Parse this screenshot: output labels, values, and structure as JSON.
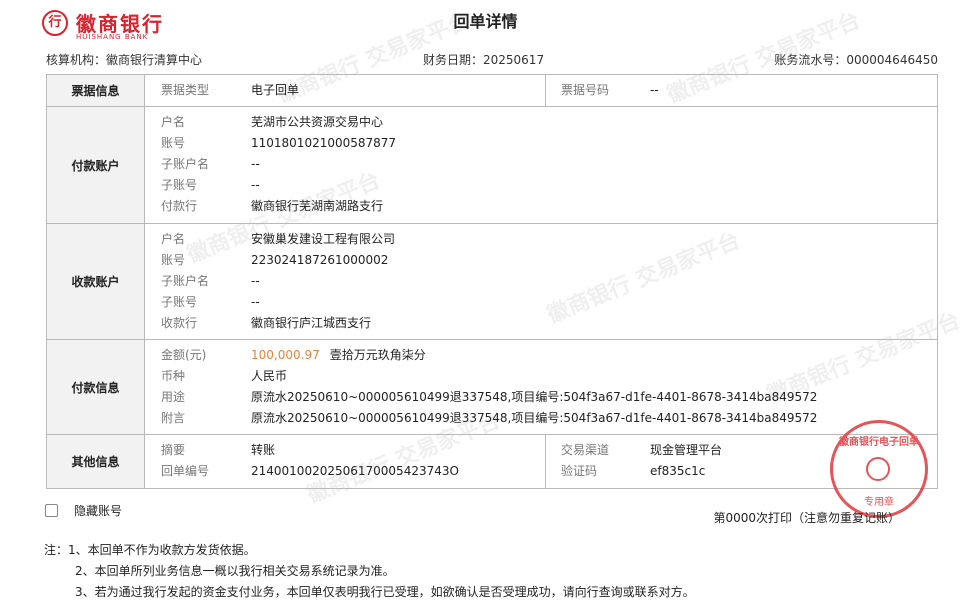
{
  "brand": {
    "name_cn": "徽商银行",
    "name_en": "HUISHANG BANK",
    "mark": "行"
  },
  "page": {
    "title": "回单详情"
  },
  "meta": {
    "org": "核算机构：徽商银行清算中心",
    "date": "财务日期：20250617",
    "serial": "账务流水号：000004646450"
  },
  "sections": {
    "bill": {
      "header": "票据信息",
      "type_label": "票据类型",
      "type_value": "电子回单",
      "no_label": "票据号码",
      "no_value": "--"
    },
    "payer": {
      "header": "付款账户",
      "rows": [
        {
          "label": "户名",
          "value": "芜湖市公共资源交易中心"
        },
        {
          "label": "账号",
          "value": "1101801021000587877"
        },
        {
          "label": "子账户名",
          "value": "--"
        },
        {
          "label": "子账号",
          "value": "--"
        },
        {
          "label": "付款行",
          "value": "徽商银行芜湖南湖路支行"
        }
      ]
    },
    "payee": {
      "header": "收款账户",
      "rows": [
        {
          "label": "户名",
          "value": "安徽巢发建设工程有限公司"
        },
        {
          "label": "账号",
          "value": "223024187261000002"
        },
        {
          "label": "子账户名",
          "value": "--"
        },
        {
          "label": "子账号",
          "value": "--"
        },
        {
          "label": "收款行",
          "value": "徽商银行庐江城西支行"
        }
      ]
    },
    "payment": {
      "header": "付款信息",
      "amount_label": "金额(元)",
      "amount_value": "100,000.97",
      "amount_cn": "壹拾万元玖角柒分",
      "currency_label": "币种",
      "currency_value": "人民币",
      "purpose_label": "用途",
      "purpose_value": "原流水20250610~000005610499退337548,项目编号:504f3a67-d1fe-4401-8678-3414ba849572",
      "note_label": "附言",
      "note_value": "原流水20250610~000005610499退337548,项目编号:504f3a67-d1fe-4401-8678-3414ba849572"
    },
    "other": {
      "header": "其他信息",
      "summary_label": "摘要",
      "summary_value": "转账",
      "receipt_no_label": "回单编号",
      "receipt_no_value": "21400100202506170005423743O",
      "channel_label": "交易渠道",
      "channel_value": "现金管理平台",
      "code_label": "验证码",
      "code_value": "ef835c1c"
    }
  },
  "hide_account": {
    "label": "隐藏账号",
    "checked": false
  },
  "print_info": "第0000次打印（注意勿重复记账）",
  "notes": [
    "注：1、本回单不作为收款方发货依据。",
    "2、本回单所列业务信息一概以我行相关交易系统记录为准。",
    "3、若为通过我行发起的资金支付业务，本回单仅表明我行已受理，如欲确认是否受理成功，请向行查询或联系对方。"
  ],
  "stamp": {
    "top_text": "徽商银行电子回单",
    "bottom_text": "专用章"
  },
  "watermark": "徽商银行 交易家平台",
  "colors": {
    "brand_red": "#d9232e",
    "amount_orange": "#e8833a",
    "header_bg": "#f2f2f2",
    "border": "#b9b9b9"
  }
}
